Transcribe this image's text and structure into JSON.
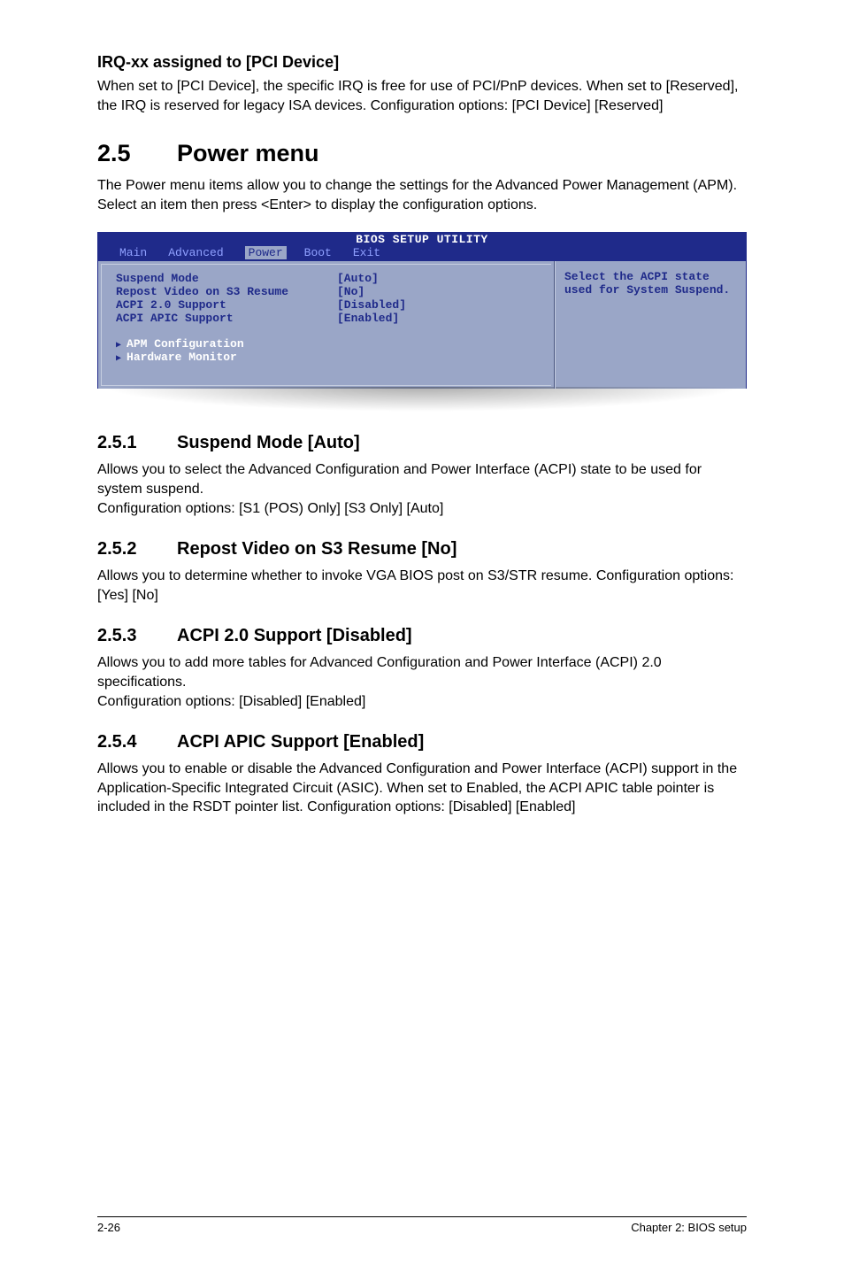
{
  "top": {
    "subheading": "IRQ-xx assigned to [PCI Device]",
    "para": "When set to [PCI Device], the specific IRQ is free for use of PCI/PnP devices. When set to [Reserved], the IRQ is reserved for legacy ISA devices. Configuration options: [PCI Device] [Reserved]"
  },
  "h1": {
    "num": "2.5",
    "title": "Power menu"
  },
  "intro": "The Power menu items allow you to change the settings for the Advanced Power Management (APM). Select an item then press <Enter> to display the configuration options.",
  "bios": {
    "title": "BIOS SETUP UTILITY",
    "tabs": [
      "Main",
      "Advanced",
      "Power",
      "Boot",
      "Exit"
    ],
    "active_tab": "Power",
    "rows": [
      {
        "label": "Suspend Mode",
        "value": "[Auto]"
      },
      {
        "label": "Repost Video on S3 Resume",
        "value": "[No]"
      },
      {
        "label": "ACPI 2.0 Support",
        "value": "[Disabled]"
      },
      {
        "label": "ACPI APIC Support",
        "value": "[Enabled]"
      }
    ],
    "subitems": [
      "APM Configuration",
      "Hardware Monitor"
    ],
    "help": "Select the ACPI state used for System Suspend."
  },
  "sections": {
    "s1": {
      "num": "2.5.1",
      "title": "Suspend Mode [Auto]",
      "p1": "Allows you to select the Advanced Configuration and Power Interface (ACPI) state to be used for system suspend.",
      "p2": "Configuration options: [S1 (POS) Only] [S3 Only] [Auto]"
    },
    "s2": {
      "num": "2.5.2",
      "title": "Repost Video on S3 Resume [No]",
      "p1": "Allows you to determine whether to invoke VGA BIOS post on S3/STR resume. Configuration options: [Yes] [No]"
    },
    "s3": {
      "num": "2.5.3",
      "title": "ACPI 2.0 Support [Disabled]",
      "p1": "Allows you to add more tables for Advanced Configuration and Power Interface (ACPI) 2.0 specifications.",
      "p2": "Configuration options:  [Disabled] [Enabled]"
    },
    "s4": {
      "num": "2.5.4",
      "title": "ACPI APIC Support [Enabled]",
      "p1": "Allows you to enable or disable the Advanced Configuration and Power Interface (ACPI) support in the Application-Specific Integrated Circuit (ASIC). When set to Enabled, the ACPI APIC table pointer is included in the RSDT pointer list. Configuration options: [Disabled] [Enabled]"
    }
  },
  "footer": {
    "left": "2-26",
    "right": "Chapter 2: BIOS setup"
  }
}
